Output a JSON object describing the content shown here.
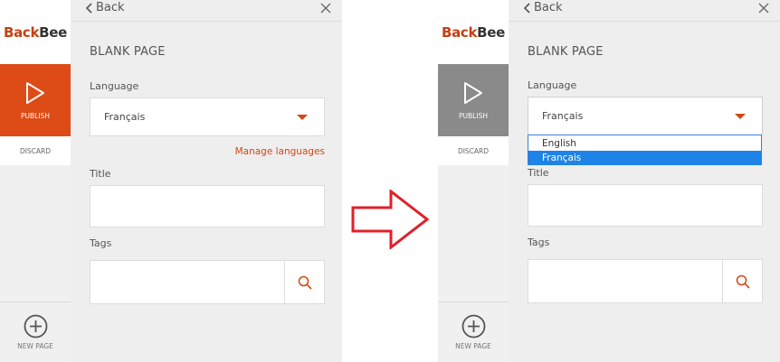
{
  "left": {
    "logo": {
      "part1": "Back",
      "part2": "Bee"
    },
    "sidebar": {
      "publish_label": "PUBLISH",
      "discard_label": "DISCARD",
      "new_page_label": "NEW PAGE"
    },
    "header": {
      "back_label": "Back"
    },
    "form": {
      "page_title": "BLANK PAGE",
      "language_label": "Language",
      "language_value": "Français",
      "manage_languages": "Manage languages",
      "title_label": "Title",
      "title_value": "",
      "tags_label": "Tags",
      "tags_value": ""
    }
  },
  "right": {
    "logo": {
      "part1": "Back",
      "part2": "Bee"
    },
    "sidebar": {
      "publish_label": "PUBLISH",
      "discard_label": "DISCARD",
      "new_page_label": "NEW PAGE"
    },
    "header": {
      "back_label": "Back"
    },
    "form": {
      "page_title": "BLANK PAGE",
      "language_label": "Language",
      "language_value": "Français",
      "title_label": "Title",
      "title_value": "",
      "tags_label": "Tags",
      "tags_value": ""
    },
    "dropdown_options": [
      "English",
      "Français"
    ]
  },
  "colors": {
    "accent": "#dd4b16",
    "publish_disabled": "#8a8a8a",
    "arrow": "#e0202a",
    "dropdown_selected": "#1e83e6"
  },
  "icons": {
    "publish": "play-triangle-icon",
    "new_page": "plus-circle-icon",
    "search": "search-icon",
    "back": "chevron-left-icon",
    "close": "close-icon",
    "transition": "right-arrow-icon"
  }
}
